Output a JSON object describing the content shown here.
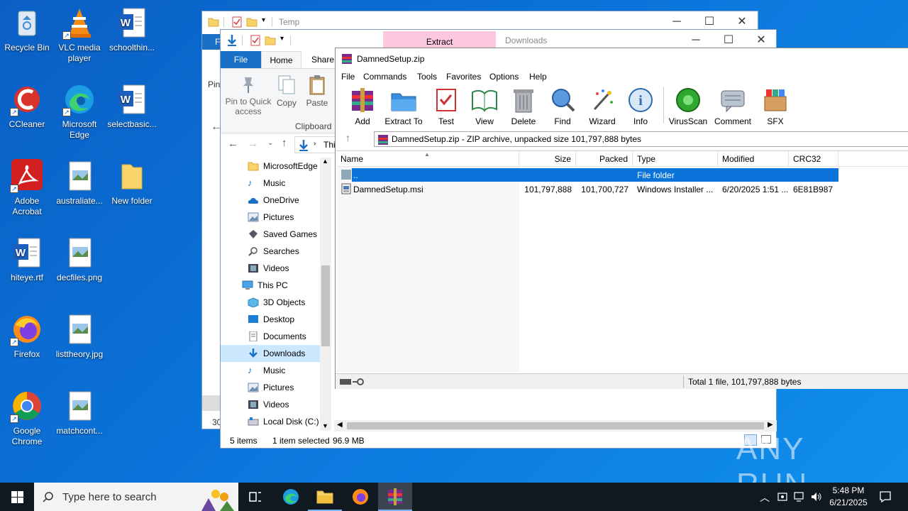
{
  "desktop": {
    "icons": [
      {
        "label": "Recycle Bin",
        "icon": "recycle-bin-icon"
      },
      {
        "label": "VLC media player",
        "icon": "vlc-icon"
      },
      {
        "label": "schoolthin...",
        "icon": "word-doc-icon"
      },
      {
        "label": "CCleaner",
        "icon": "ccleaner-icon"
      },
      {
        "label": "Microsoft Edge",
        "icon": "edge-icon"
      },
      {
        "label": "selectbasic...",
        "icon": "word-doc-icon"
      },
      {
        "label": "Adobe Acrobat",
        "icon": "acrobat-icon"
      },
      {
        "label": "australiate...",
        "icon": "image-file-icon"
      },
      {
        "label": "New folder",
        "icon": "folder-icon"
      },
      {
        "label": "hiteye.rtf",
        "icon": "word-doc-icon"
      },
      {
        "label": "decfiles.png",
        "icon": "image-file-icon"
      },
      {
        "label": "Firefox",
        "icon": "firefox-icon"
      },
      {
        "label": "listtheory.jpg",
        "icon": "image-file-icon"
      },
      {
        "label": "Google Chrome",
        "icon": "chrome-icon"
      },
      {
        "label": "matchcont...",
        "icon": "image-file-icon"
      }
    ]
  },
  "temp_window": {
    "title": "Temp",
    "side_letter": "F",
    "side_fragments": [
      "Pin",
      "30"
    ]
  },
  "downloads_window": {
    "title": "Downloads",
    "extract_tab": "Extract",
    "ribbon_tabs": [
      "File",
      "Home",
      "Share"
    ],
    "ribbon_buttons": {
      "pin": "Pin to Quick access",
      "copy": "Copy",
      "paste": "Paste"
    },
    "clipboard_group": "Clipboard",
    "address_fragment": "Thi",
    "nav_items": [
      {
        "label": "MicrosoftEdge",
        "icon": "folder-icon"
      },
      {
        "label": "Music",
        "icon": "music-icon"
      },
      {
        "label": "OneDrive",
        "icon": "onedrive-icon"
      },
      {
        "label": "Pictures",
        "icon": "pictures-icon"
      },
      {
        "label": "Saved Games",
        "icon": "saved-games-icon"
      },
      {
        "label": "Searches",
        "icon": "search-icon"
      },
      {
        "label": "Videos",
        "icon": "videos-icon"
      },
      {
        "label": "This PC",
        "icon": "computer-icon"
      },
      {
        "label": "3D Objects",
        "icon": "3d-objects-icon"
      },
      {
        "label": "Desktop",
        "icon": "desktop-icon"
      },
      {
        "label": "Documents",
        "icon": "documents-icon"
      },
      {
        "label": "Downloads",
        "icon": "downloads-icon"
      },
      {
        "label": "Music",
        "icon": "music-icon"
      },
      {
        "label": "Pictures",
        "icon": "pictures-icon"
      },
      {
        "label": "Videos",
        "icon": "videos-icon"
      },
      {
        "label": "Local Disk (C:)",
        "icon": "drive-icon"
      }
    ],
    "status": {
      "items": "5 items",
      "selected": "1 item selected",
      "size": "96.9 MB"
    }
  },
  "winrar": {
    "title": "DamnedSetup.zip",
    "menu": [
      "File",
      "Commands",
      "Tools",
      "Favorites",
      "Options",
      "Help"
    ],
    "toolbar": [
      {
        "label": "Add",
        "icon": "add-archive-icon"
      },
      {
        "label": "Extract To",
        "icon": "extract-to-icon"
      },
      {
        "label": "Test",
        "icon": "test-icon"
      },
      {
        "label": "View",
        "icon": "view-icon"
      },
      {
        "label": "Delete",
        "icon": "delete-icon"
      },
      {
        "label": "Find",
        "icon": "find-icon"
      },
      {
        "label": "Wizard",
        "icon": "wizard-icon"
      },
      {
        "label": "Info",
        "icon": "info-icon"
      },
      {
        "label": "VirusScan",
        "icon": "virusscan-icon"
      },
      {
        "label": "Comment",
        "icon": "comment-icon"
      },
      {
        "label": "SFX",
        "icon": "sfx-icon"
      }
    ],
    "path": "DamnedSetup.zip - ZIP archive, unpacked size 101,797,888 bytes",
    "columns": [
      "Name",
      "Size",
      "Packed",
      "Type",
      "Modified",
      "CRC32"
    ],
    "rows": [
      {
        "name": "..",
        "size": "",
        "packed": "",
        "type": "File folder",
        "modified": "",
        "crc": ""
      },
      {
        "name": "DamnedSetup.msi",
        "size": "101,797,888",
        "packed": "101,700,727",
        "type": "Windows Installer ...",
        "modified": "6/20/2025 1:51 ...",
        "crc": "6E81B987"
      }
    ],
    "status": "Total 1 file, 101,797,888 bytes"
  },
  "taskbar": {
    "search_placeholder": "Type here to search",
    "time": "5:48 PM",
    "date": "6/21/2025"
  },
  "watermark": "ANY RUN",
  "colors": {
    "selection": "#0a74da",
    "taskbar": "#101820",
    "desktop": "#0b74da"
  }
}
